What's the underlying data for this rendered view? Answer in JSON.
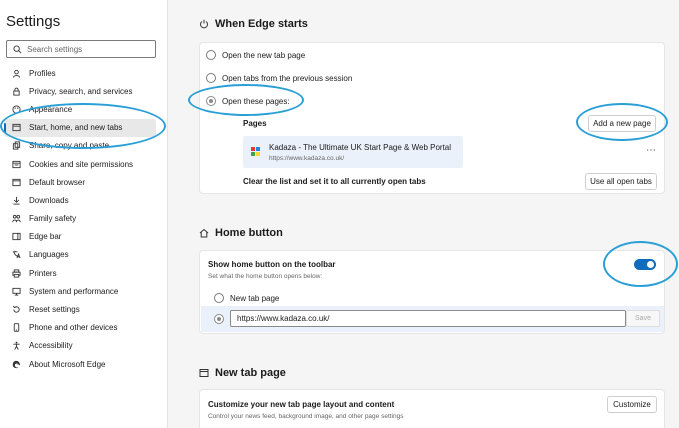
{
  "sidebar": {
    "title": "Settings",
    "search_placeholder": "Search settings",
    "items": [
      {
        "label": "Profiles",
        "icon": "profile-icon"
      },
      {
        "label": "Privacy, search, and services",
        "icon": "lock-icon"
      },
      {
        "label": "Appearance",
        "icon": "palette-icon"
      },
      {
        "label": "Start, home, and new tabs",
        "icon": "start-icon",
        "active": true
      },
      {
        "label": "Share, copy and paste",
        "icon": "share-icon"
      },
      {
        "label": "Cookies and site permissions",
        "icon": "cookie-icon"
      },
      {
        "label": "Default browser",
        "icon": "browser-icon"
      },
      {
        "label": "Downloads",
        "icon": "download-icon"
      },
      {
        "label": "Family safety",
        "icon": "family-icon"
      },
      {
        "label": "Edge bar",
        "icon": "edge-bar-icon"
      },
      {
        "label": "Languages",
        "icon": "language-icon"
      },
      {
        "label": "Printers",
        "icon": "printer-icon"
      },
      {
        "label": "System and performance",
        "icon": "system-icon"
      },
      {
        "label": "Reset settings",
        "icon": "reset-icon"
      },
      {
        "label": "Phone and other devices",
        "icon": "phone-icon"
      },
      {
        "label": "Accessibility",
        "icon": "accessibility-icon"
      },
      {
        "label": "About Microsoft Edge",
        "icon": "edge-icon"
      }
    ]
  },
  "startup": {
    "title": "When Edge starts",
    "option_new_tab": "Open the new tab page",
    "option_previous": "Open tabs from the previous session",
    "option_pages": "Open these pages:",
    "pages_label": "Pages",
    "add_page_button": "Add a new page",
    "page_title": "Kadaza - The Ultimate UK Start Page & Web Portal",
    "page_url": "https://www.kadaza.co.uk/",
    "more_button": "⋯",
    "clear_text": "Clear the list and set it to all currently open tabs",
    "use_open_tabs_button": "Use all open tabs"
  },
  "home": {
    "title": "Home button",
    "show_label": "Show home button on the toolbar",
    "show_desc": "Set what the home button opens below:",
    "toggle_on": true,
    "option_new_tab": "New tab page",
    "url_value": "https://www.kadaza.co.uk/",
    "save_button": "Save"
  },
  "newtab": {
    "title": "New tab page",
    "customize_label": "Customize your new tab page layout and content",
    "customize_desc": "Control your news feed, background image, and other page settings",
    "customize_button": "Customize"
  },
  "colors": {
    "accent": "#0f6cbd",
    "annotation": "#2a9fd6"
  }
}
